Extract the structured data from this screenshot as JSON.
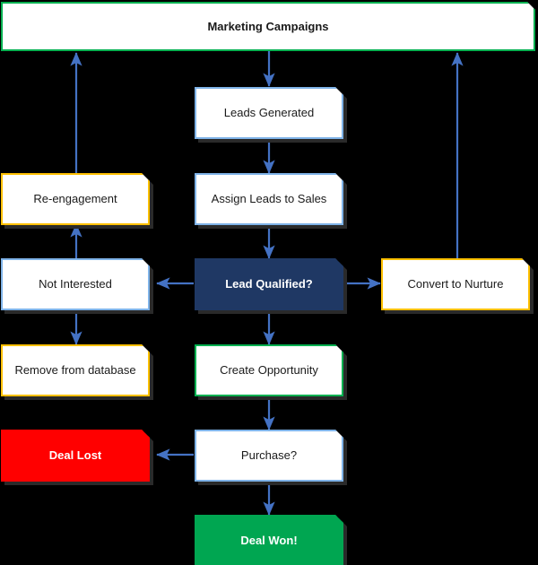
{
  "diagram": {
    "title": "Marketing Campaigns",
    "background_color": "#000000",
    "palette": {
      "arrow": "#4472C4",
      "border_blue": "#7FB3E8",
      "border_orange": "#FFC000",
      "border_green": "#00B050",
      "fill_navy": "#1F3864",
      "fill_red": "#FF0000",
      "fill_green": "#00A651",
      "fill_white": "#FFFFFF",
      "text_dark": "#1A1A1A",
      "text_light": "#FFFFFF"
    },
    "nodes": [
      {
        "id": "marketing_campaigns",
        "label": "Marketing Campaigns"
      },
      {
        "id": "leads_generated",
        "label": "Leads Generated"
      },
      {
        "id": "assign_leads",
        "label": "Assign Leads to Sales"
      },
      {
        "id": "re_engagement",
        "label": "Re-engagement"
      },
      {
        "id": "lead_qualified",
        "label": "Lead Qualified?"
      },
      {
        "id": "not_interested",
        "label": "Not Interested"
      },
      {
        "id": "convert_to_nurture",
        "label": "Convert to Nurture"
      },
      {
        "id": "remove_from_database",
        "label": "Remove from database"
      },
      {
        "id": "create_opportunity",
        "label": "Create Opportunity"
      },
      {
        "id": "deal_lost",
        "label": "Deal Lost"
      },
      {
        "id": "purchase",
        "label": "Purchase?"
      },
      {
        "id": "deal_won",
        "label": "Deal Won!"
      }
    ],
    "edges": [
      {
        "from": "marketing_campaigns",
        "to": "leads_generated"
      },
      {
        "from": "leads_generated",
        "to": "assign_leads"
      },
      {
        "from": "assign_leads",
        "to": "lead_qualified"
      },
      {
        "from": "lead_qualified",
        "to": "not_interested"
      },
      {
        "from": "lead_qualified",
        "to": "convert_to_nurture"
      },
      {
        "from": "lead_qualified",
        "to": "create_opportunity"
      },
      {
        "from": "not_interested",
        "to": "re_engagement"
      },
      {
        "from": "not_interested",
        "to": "remove_from_database"
      },
      {
        "from": "re_engagement",
        "to": "marketing_campaigns"
      },
      {
        "from": "convert_to_nurture",
        "to": "marketing_campaigns"
      },
      {
        "from": "create_opportunity",
        "to": "purchase"
      },
      {
        "from": "purchase",
        "to": "deal_lost"
      },
      {
        "from": "purchase",
        "to": "deal_won"
      }
    ]
  }
}
